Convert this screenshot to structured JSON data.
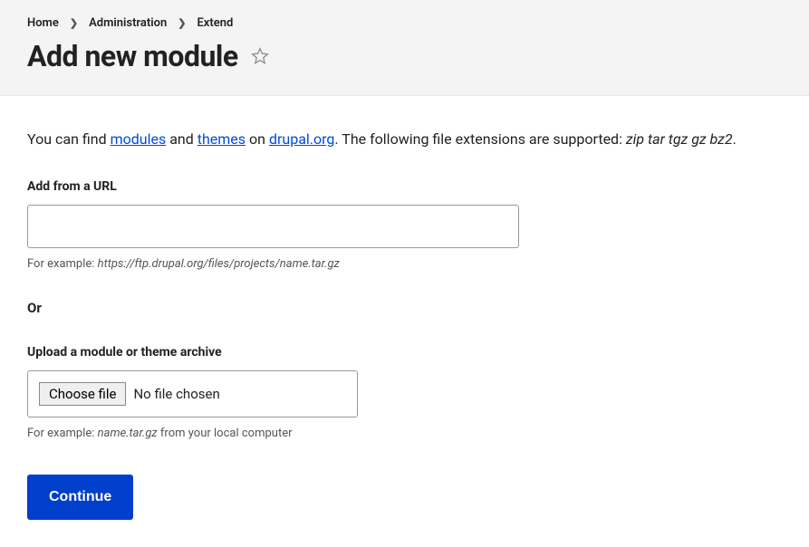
{
  "breadcrumb": {
    "home": "Home",
    "administration": "Administration",
    "extend": "Extend"
  },
  "page_title": "Add new module",
  "intro": {
    "prefix": "You can find ",
    "modules_link": "modules",
    "mid1": " and ",
    "themes_link": "themes",
    "mid2": " on ",
    "drupal_link": "drupal.org",
    "suffix1": ". The following file extensions are supported: ",
    "extensions": "zip tar tgz gz bz2",
    "suffix2": "."
  },
  "url_section": {
    "label": "Add from a URL",
    "value": "",
    "help_prefix": "For example: ",
    "help_example": "https://ftp.drupal.org/files/projects/name.tar.gz"
  },
  "or_label": "Or",
  "upload_section": {
    "label": "Upload a module or theme archive",
    "choose_file": "Choose file",
    "file_status": "No file chosen",
    "help_prefix": "For example: ",
    "help_example": "name.tar.gz",
    "help_suffix": " from your local computer"
  },
  "continue_label": "Continue"
}
